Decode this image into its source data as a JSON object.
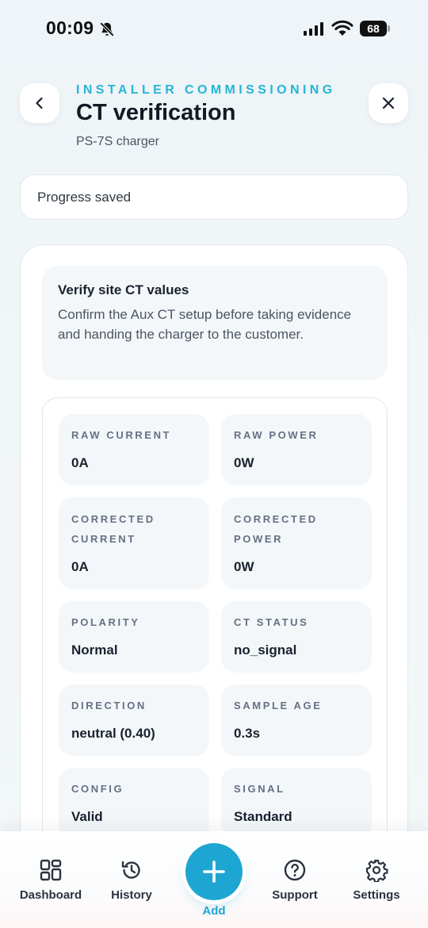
{
  "status_bar": {
    "time": "00:09",
    "battery": "68"
  },
  "header": {
    "eyebrow": "INSTALLER COMMISSIONING",
    "title": "CT verification",
    "subtitle": "PS-7S charger"
  },
  "progress_banner": "Progress saved",
  "info": {
    "title": "Verify site CT values",
    "text": "Confirm the Aux CT setup before taking evidence and handing the charger to the customer."
  },
  "metrics": [
    {
      "label": "RAW CURRENT",
      "value": "0A"
    },
    {
      "label": "RAW POWER",
      "value": "0W"
    },
    {
      "label": "CORRECTED CURRENT",
      "value": "0A"
    },
    {
      "label": "CORRECTED POWER",
      "value": "0W"
    },
    {
      "label": "POLARITY",
      "value": "Normal"
    },
    {
      "label": "CT STATUS",
      "value": "no_signal"
    },
    {
      "label": "DIRECTION",
      "value": "neutral (0.40)"
    },
    {
      "label": "SAMPLE AGE",
      "value": "0.3s"
    },
    {
      "label": "CONFIG",
      "value": "Valid"
    },
    {
      "label": "SIGNAL",
      "value": "Standard"
    }
  ],
  "nav": {
    "dashboard": "Dashboard",
    "history": "History",
    "add": "Add",
    "support": "Support",
    "settings": "Settings"
  },
  "colors": {
    "accent": "#1ea6d3",
    "eyebrow": "#23b6d6"
  }
}
